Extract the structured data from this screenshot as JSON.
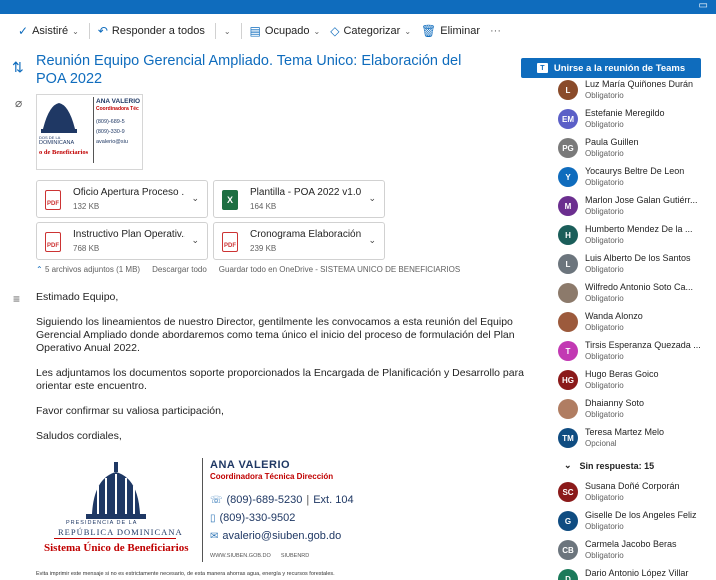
{
  "toolbar": {
    "attend": "Asistiré",
    "reply_all": "Responder a todos",
    "busy": "Ocupado",
    "categorize": "Categorizar",
    "delete": "Eliminar",
    "more": "···"
  },
  "header": {
    "subject": "Reunión Equipo Gerencial Ampliado. Tema Unico: Elaboración del POA 2022",
    "teams_button": "Unirse a la reunión de Teams"
  },
  "thumb": {
    "name": "ANA VALERIO",
    "role": "Coordinadora Téc",
    "phone1": "(809)-689-5",
    "phone2": "(809)-330-9",
    "email": "avalerio@siu",
    "rep1": "DOS DE LA",
    "rep2": "DOMINICANA",
    "sistema": "o de Beneficiarios"
  },
  "attachments": [
    {
      "name": "Oficio Apertura Proceso ...",
      "size": "132 KB",
      "type": "pdf"
    },
    {
      "name": "Plantilla - POA 2022 v1.0....",
      "size": "164 KB",
      "type": "xls"
    },
    {
      "name": "Instructivo Plan Operativ...",
      "size": "768 KB",
      "type": "pdf"
    },
    {
      "name": "Cronograma Elaboración...",
      "size": "239 KB",
      "type": "pdf"
    }
  ],
  "attachments_footer": {
    "count": "5 archivos adjuntos (1 MB)",
    "download": "Descargar todo",
    "save": "Guardar todo en OneDrive - SISTEMA UNICO DE BENEFICIARIOS"
  },
  "body": {
    "greeting": "Estimado Equipo,",
    "p1": "Siguiendo los lineamientos de nuestro Director, gentilmente les convocamos a esta reunión del Equipo Gerencial Ampliado donde abordaremos como tema único el inicio del proceso de formulación del Plan Operativo Anual 2022.",
    "p2": "Les adjuntamos los documentos soporte proporcionados la Encargada de Planificación y Desarrollo para orientar este encuentro.",
    "p3": "Favor confirmar su valiosa participación,",
    "closing": "Saludos cordiales,"
  },
  "signature": {
    "name": "ANA VALERIO",
    "role": "Coordinadora Técnica Dirección",
    "phone1": "(809)-689-5230",
    "ext": "Ext. 104",
    "phone2": "(809)-330-9502",
    "email": "avalerio@siuben.gob.do",
    "web": "WWW.SIUBEN.GOB.DO",
    "social": "SIUBENRD",
    "presidencia": "PRESIDENCIA DE LA",
    "republica": "REPÚBLICA DOMINICANA",
    "sistema": "Sistema Único de Beneficiarios",
    "footer": "Evita imprimir este mensaje si no es estrictamente necesario, de esta manera ahorras agua, energía y recursos forestales."
  },
  "attendees": [
    {
      "name": "Luz María Quiñones Durán",
      "status": "Obligatorio",
      "initials": "L",
      "color": "#8a4b2a"
    },
    {
      "name": "Estefanie Meregildo",
      "status": "Obligatorio",
      "initials": "EM",
      "color": "#5b5fc7"
    },
    {
      "name": "Paula Guillen",
      "status": "Obligatorio",
      "initials": "PG",
      "color": "#7a7a7a"
    },
    {
      "name": "Yocaurys Beltre De Leon",
      "status": "Obligatorio",
      "initials": "Y",
      "color": "#0f6cbd"
    },
    {
      "name": "Marlon Jose Galan Gutiérr...",
      "status": "Obligatorio",
      "initials": "M",
      "color": "#6b2e8f"
    },
    {
      "name": "Humberto Mendez De la ...",
      "status": "Obligatorio",
      "initials": "H",
      "color": "#1b5e5a"
    },
    {
      "name": "Luis Alberto De los Santos",
      "status": "Obligatorio",
      "initials": "L",
      "color": "#6c757d"
    },
    {
      "name": "Wilfredo Antonio Soto Ca...",
      "status": "Obligatorio",
      "initials": "",
      "color": "#8c7a6b"
    },
    {
      "name": "Wanda Alonzo",
      "status": "Obligatorio",
      "initials": "",
      "color": "#9c5a3c"
    },
    {
      "name": "Tirsis Esperanza Quezada ...",
      "status": "Obligatorio",
      "initials": "T",
      "color": "#c239b3"
    },
    {
      "name": "Hugo Beras Goico",
      "status": "Obligatorio",
      "initials": "HG",
      "color": "#8b1a1a"
    },
    {
      "name": "Dhaianny Soto",
      "status": "Obligatorio",
      "initials": "",
      "color": "#b07d62"
    },
    {
      "name": "Teresa Martez Melo",
      "status": "Opcional",
      "initials": "TM",
      "color": "#0f4c81"
    }
  ],
  "no_response": "Sin respuesta: 15",
  "attendees_noresp": [
    {
      "name": "Susana Doñé Corporán",
      "status": "Obligatorio",
      "initials": "SC",
      "color": "#8b1a1a"
    },
    {
      "name": "Giselle De los Angeles Feliz",
      "status": "Obligatorio",
      "initials": "G",
      "color": "#0f4c81"
    },
    {
      "name": "Carmela Jacobo Beras",
      "status": "Obligatorio",
      "initials": "CB",
      "color": "#6c757d"
    },
    {
      "name": "Dario Antonio López Villar",
      "status": "Obligatorio",
      "initials": "D",
      "color": "#1b7a5a"
    }
  ]
}
